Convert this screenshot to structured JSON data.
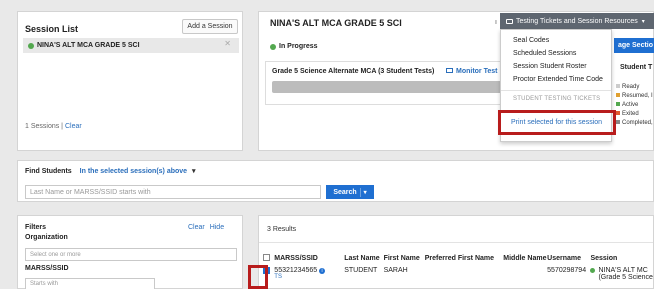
{
  "session_list": {
    "title": "Session List",
    "add_button": "Add a Session",
    "selected_session": "NINA'S ALT MCA GRADE 5 SCI",
    "footer_count": "1 Sessions |",
    "footer_clear": "Clear"
  },
  "session_detail": {
    "title": "NINA'S ALT MCA GRADE 5 SCI",
    "status": "In Progress",
    "test_name": "Grade 5 Science Alternate MCA (3 Student Tests)",
    "monitor_label": "Monitor Test",
    "manage_label": "age Sectio",
    "student_label": "Student T",
    "legend": [
      "Ready",
      "Resumed, I",
      "Active",
      "Exited",
      "Completed,"
    ]
  },
  "dropdown": {
    "toggle_label": "Testing Tickets and Session Resources",
    "items": [
      "Seal Codes",
      "Scheduled Sessions",
      "Session Student Roster",
      "Proctor Extended Time Code"
    ],
    "section_header": "STUDENT TESTING TICKETS",
    "print_item": "Print selected for this session"
  },
  "find_students": {
    "title": "Find Students",
    "scope_label": "In the selected session(s) above",
    "search_placeholder": "Last Name or MARSS/SSID starts with",
    "search_button": "Search"
  },
  "filters": {
    "title": "Filters",
    "clear_label": "Clear",
    "hide_label": "Hide",
    "organization_label": "Organization",
    "organization_placeholder": "Select one or more",
    "marss_label": "MARSS/SSID",
    "marss_placeholder": "Starts with"
  },
  "results": {
    "count_label": "3 Results",
    "columns": [
      "MARSS/SSID",
      "Last Name",
      "First Name",
      "Preferred First Name",
      "Middle Name",
      "Username",
      "Session"
    ],
    "row": {
      "marss": "55321234565",
      "marss_extra": "TS",
      "last": "STUDENT",
      "first": "SARAH",
      "preferred": "",
      "middle": "",
      "username": "5570298794",
      "session": "NINA'S ALT MC",
      "session_sub": "(Grade 5 Science"
    }
  },
  "colors": {
    "accent_blue": "#1f6fd1",
    "status_green": "#53a84f",
    "highlight_red": "#b81c1c",
    "header_gray": "#5e6670"
  }
}
